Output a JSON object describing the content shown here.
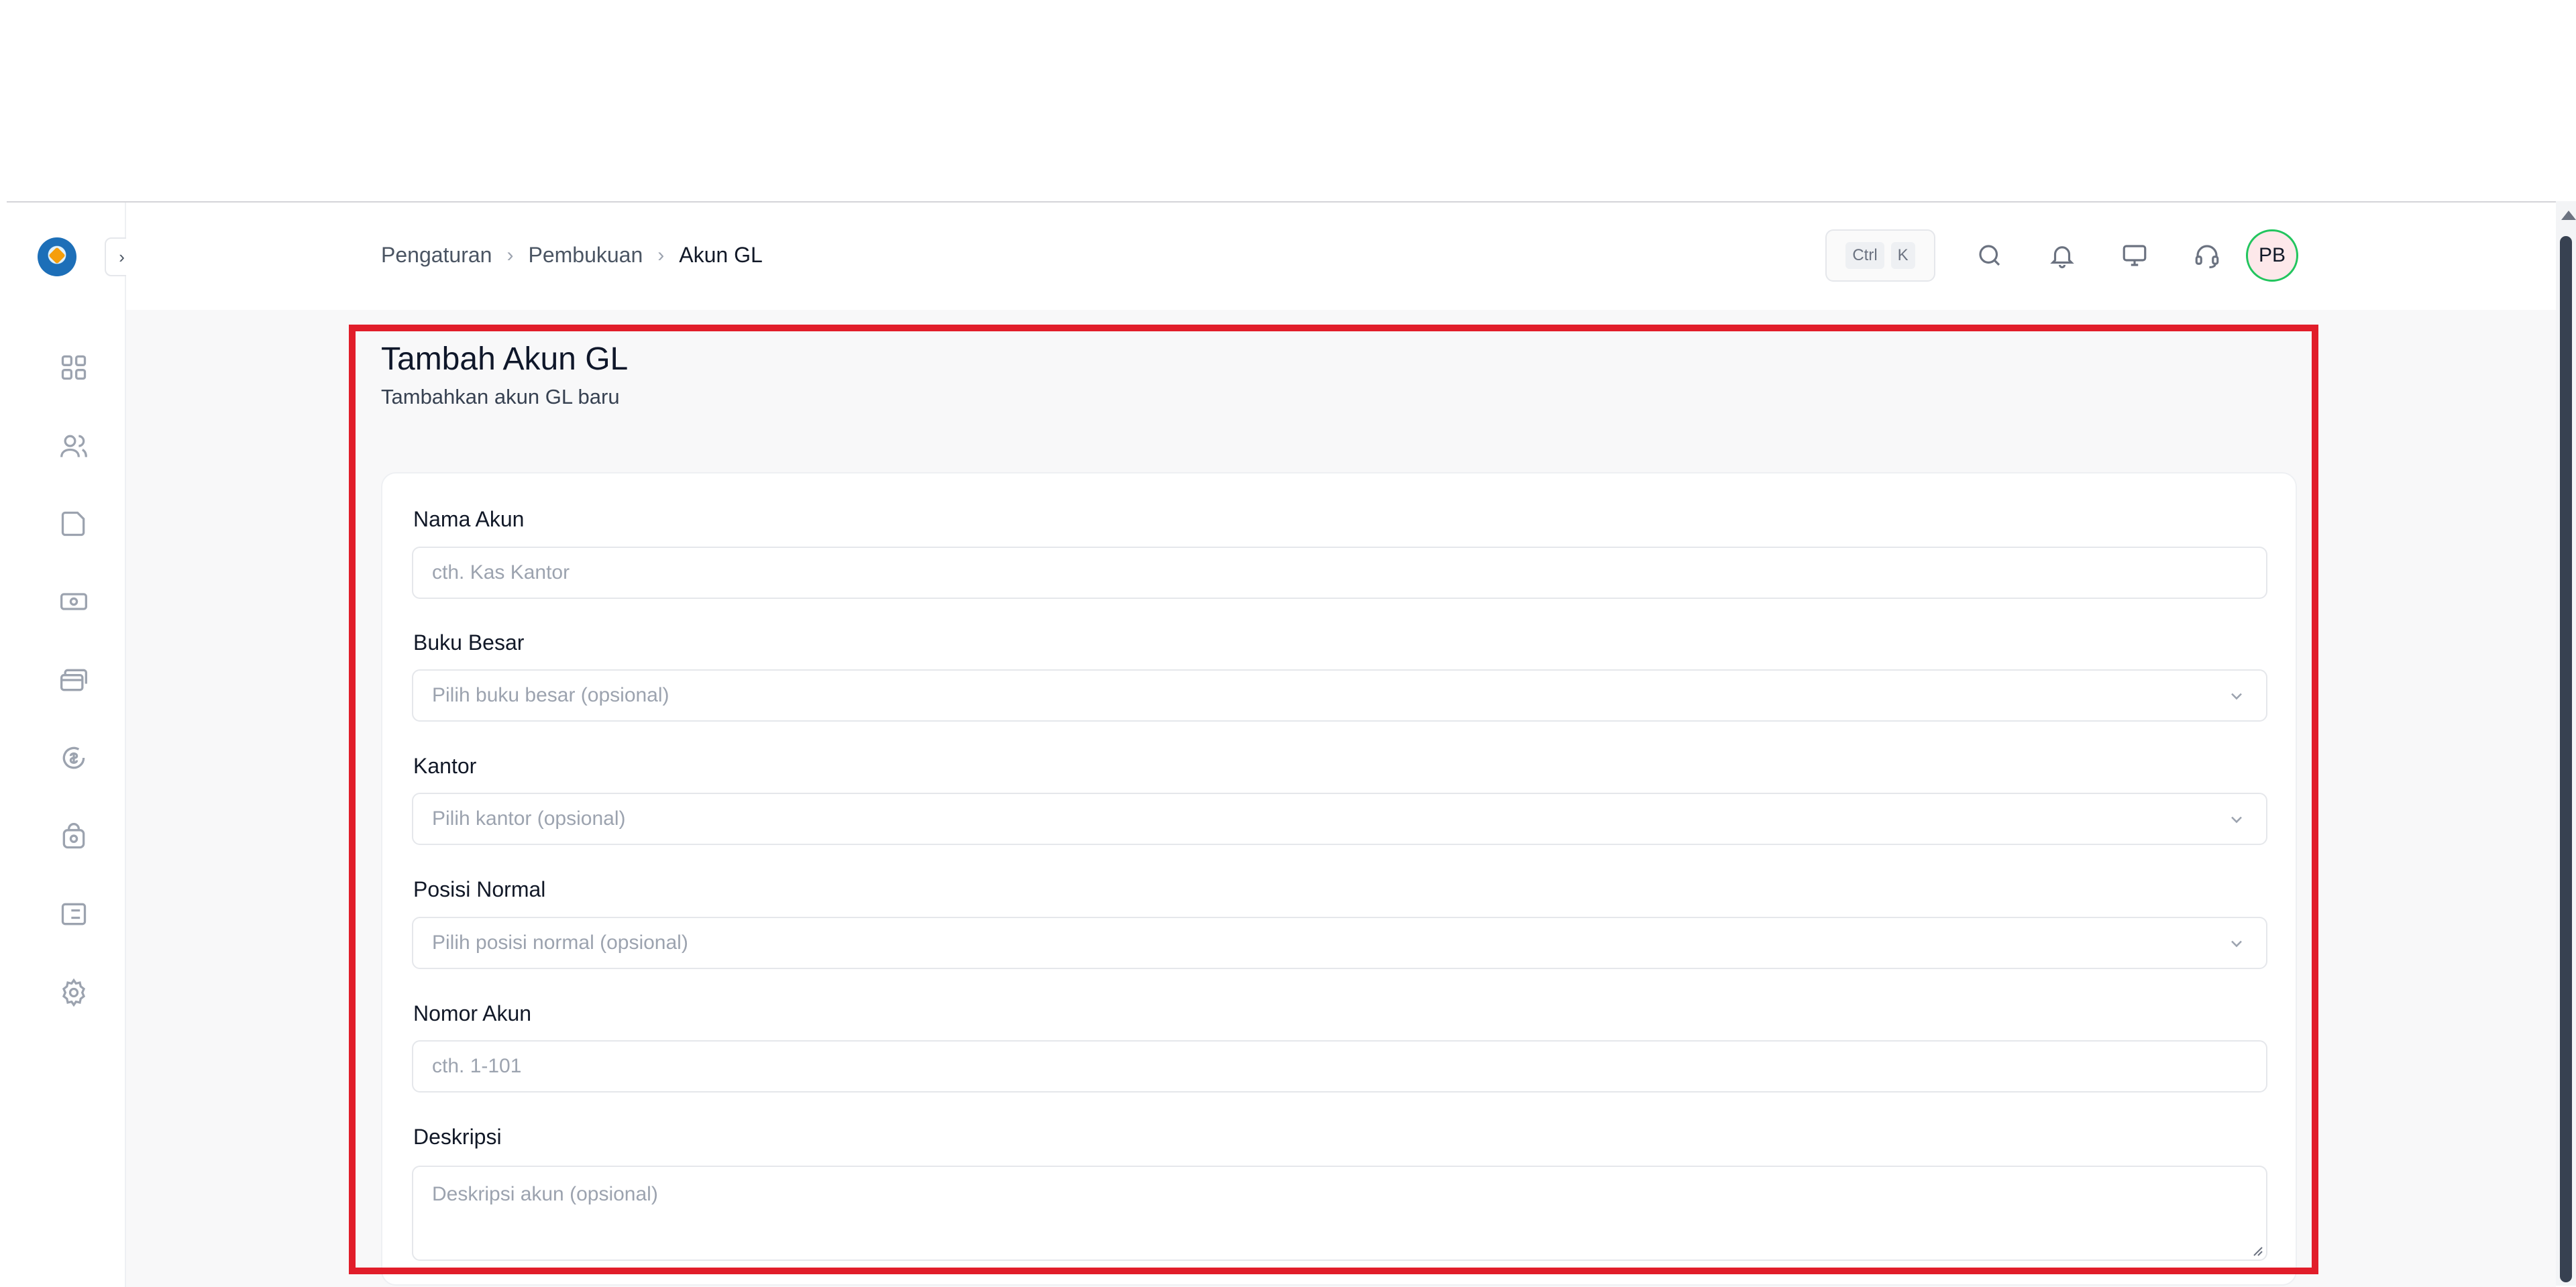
{
  "breadcrumb": {
    "items": [
      "Pengaturan",
      "Pembukuan"
    ],
    "current": "Akun GL"
  },
  "header": {
    "shortcut": {
      "ctrl": "Ctrl",
      "key": "K"
    },
    "avatar_initials": "PB"
  },
  "page": {
    "title": "Tambah Akun GL",
    "subtitle": "Tambahkan akun GL baru"
  },
  "form": {
    "nama_akun": {
      "label": "Nama Akun",
      "placeholder": "cth. Kas Kantor",
      "value": ""
    },
    "buku_besar": {
      "label": "Buku Besar",
      "placeholder": "Pilih buku besar (opsional)"
    },
    "kantor": {
      "label": "Kantor",
      "placeholder": "Pilih kantor (opsional)"
    },
    "posisi_normal": {
      "label": "Posisi Normal",
      "placeholder": "Pilih posisi normal (opsional)"
    },
    "nomor_akun": {
      "label": "Nomor Akun",
      "placeholder": "cth. 1-101",
      "value": ""
    },
    "deskripsi": {
      "label": "Deskripsi",
      "placeholder": "Deskripsi akun (opsional)",
      "value": ""
    }
  },
  "colors": {
    "highlight": "#e11d2a",
    "avatar_ring": "#22c55e",
    "avatar_bg": "#fde8ea"
  },
  "icons": {
    "sidebar": [
      "dashboard-icon",
      "users-icon",
      "folder-icon",
      "cash-icon",
      "cards-icon",
      "savings-icon",
      "lock-icon",
      "report-icon",
      "gear-icon"
    ],
    "header": [
      "search-icon",
      "bell-icon",
      "monitor-icon",
      "headset-icon"
    ]
  }
}
